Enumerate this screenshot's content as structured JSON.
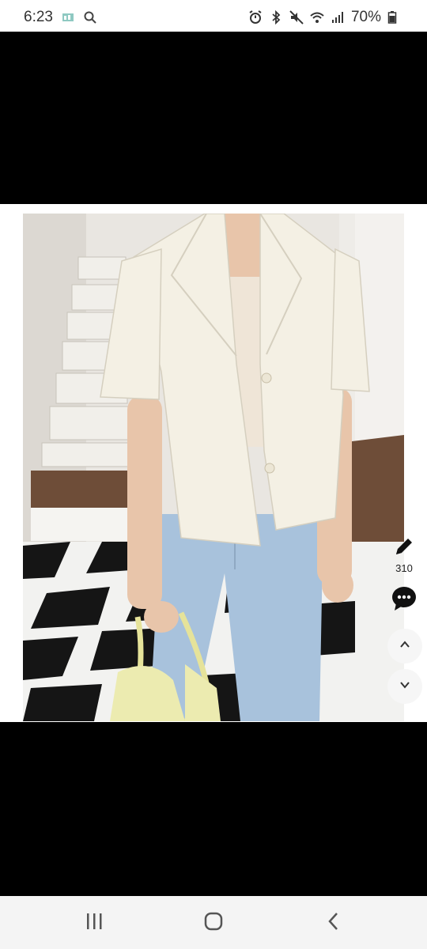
{
  "status": {
    "time": "6:23",
    "battery": "70%",
    "left_icons": [
      "gallery-icon",
      "search-icon"
    ],
    "right_icons": [
      "alarm-icon",
      "bluetooth-icon",
      "mute-icon",
      "wifi-icon",
      "signal-icon",
      "battery-icon"
    ]
  },
  "side_actions": {
    "edit_icon": "pencil-icon",
    "count": "310",
    "chat_icon": "chat-icon",
    "up_icon": "chevron-up-icon",
    "down_icon": "chevron-down-icon"
  },
  "nav": {
    "icons": [
      "recents-icon",
      "home-icon",
      "back-icon"
    ]
  },
  "colors": {
    "status_bg": "#ffffff",
    "viewer_bg": "#000000",
    "nav_bg": "#f4f4f4",
    "blazer": "#f4f0e4",
    "jeans": "#a8c2dc"
  }
}
